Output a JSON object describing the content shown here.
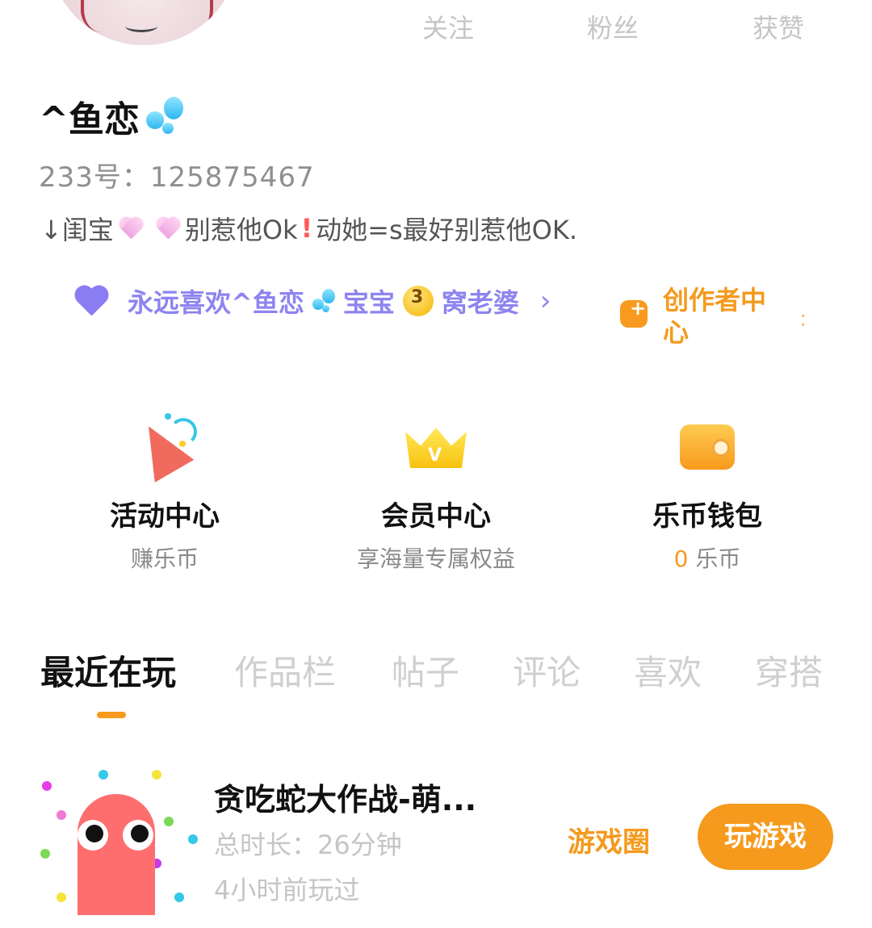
{
  "profile": {
    "stats": {
      "following_label": "关注",
      "fans_label": "粉丝",
      "likes_label": "获赞"
    },
    "name": "^鱼恋",
    "uid": "233号：125875467",
    "bio": {
      "part1": "↓闺宝",
      "part2": "别惹他Ok",
      "part3": "动她=s最好别惹他OK."
    },
    "fav_link": {
      "part1": "永远喜欢^鱼恋",
      "part2": "宝宝",
      "part3": "窝老婆",
      "chevron": "›"
    },
    "creator_center": "创作者中心"
  },
  "features": [
    {
      "title": "活动中心",
      "subtitle": "赚乐币",
      "icon": "party-popper-icon"
    },
    {
      "title": "会员中心",
      "subtitle": "享海量专属权益",
      "icon": "crown-icon"
    },
    {
      "title": "乐币钱包",
      "coin_count": "0",
      "coin_unit": "乐币",
      "icon": "wallet-icon"
    }
  ],
  "tabs": [
    "最近在玩",
    "作品栏",
    "帖子",
    "评论",
    "喜欢",
    "穿搭"
  ],
  "active_tab": "最近在玩",
  "recent_game": {
    "title": "贪吃蛇大作战-萌...",
    "duration": "总时长：26分钟",
    "last_played": "4小时前玩过",
    "circle_label": "游戏圈",
    "play_label": "玩游戏"
  },
  "colors": {
    "accent_orange": "#f59a1d",
    "purple": "#8d84f0",
    "muted": "#c5c5c5"
  }
}
